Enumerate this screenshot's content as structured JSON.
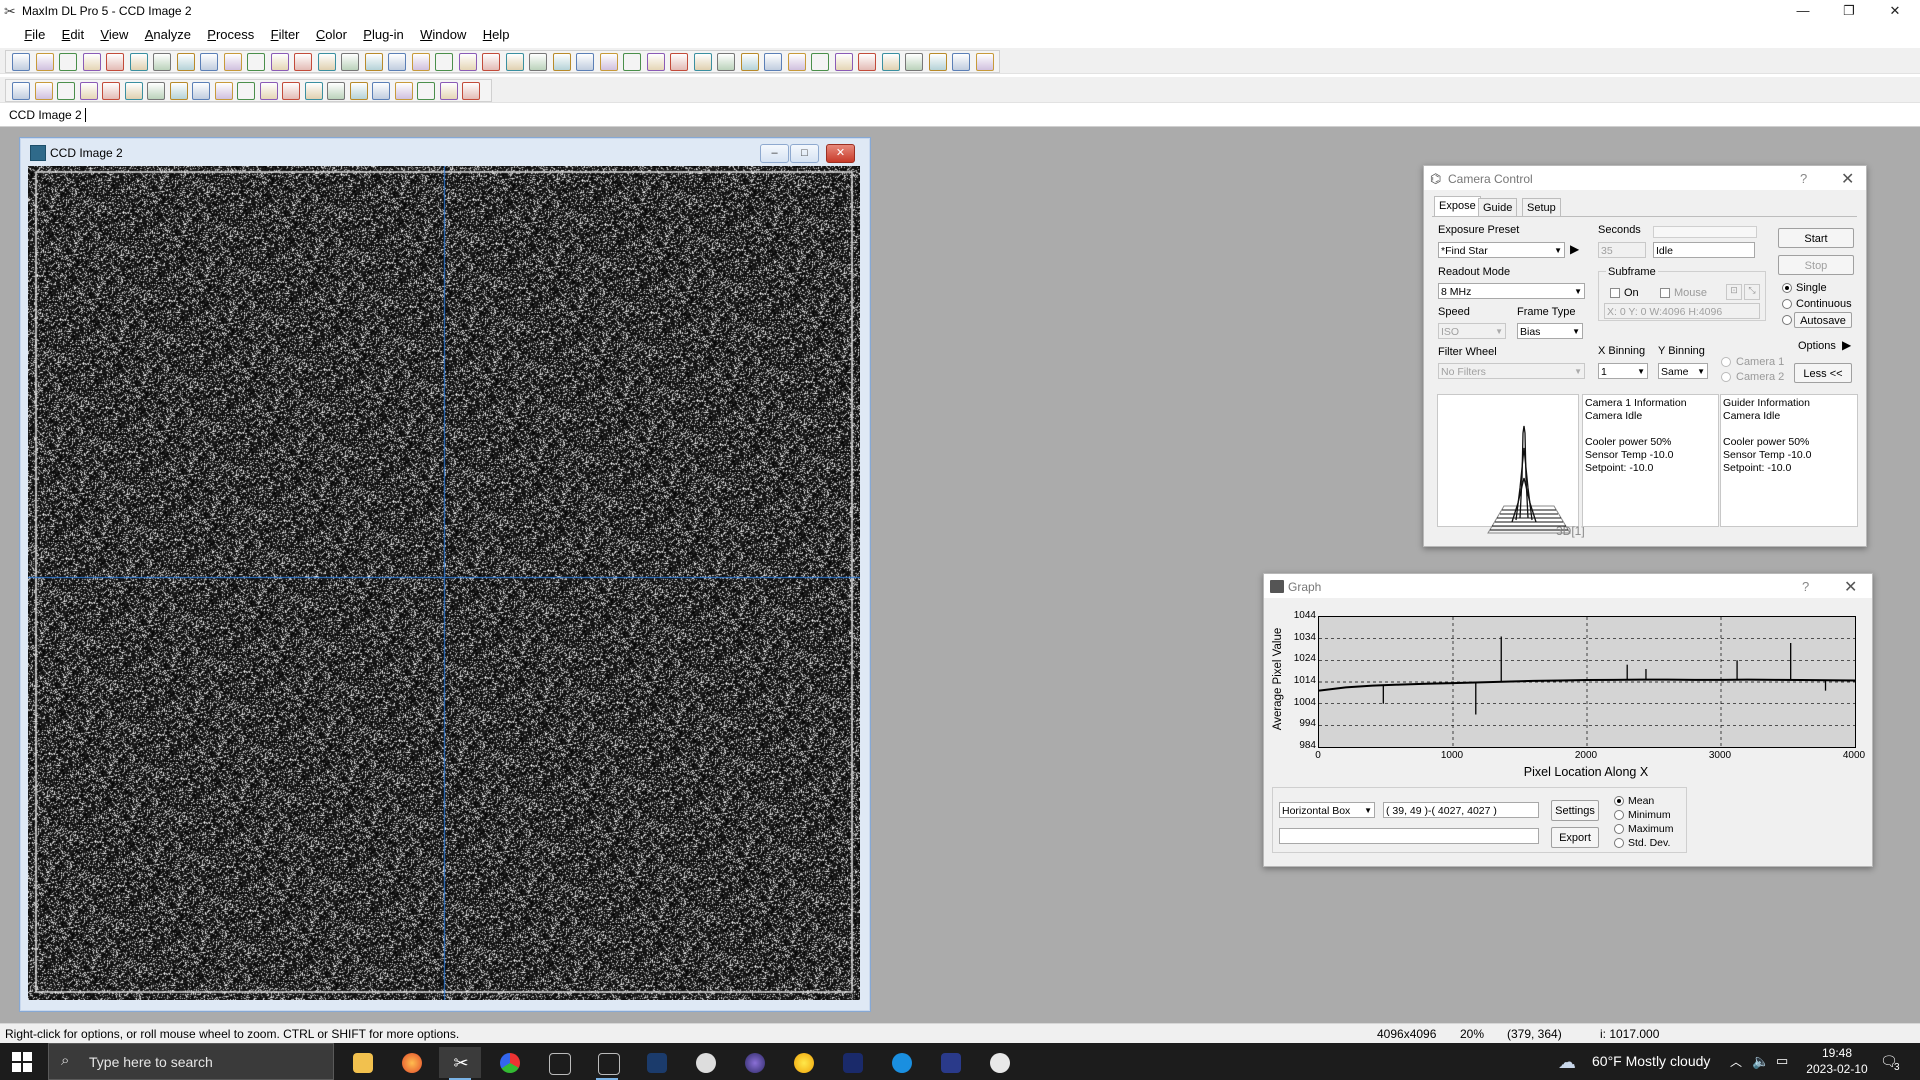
{
  "app": {
    "title": "MaxIm DL Pro 5 - CCD Image 2",
    "window_controls": {
      "minimize": "—",
      "restore": "❐",
      "close": "✕"
    }
  },
  "menu": [
    "File",
    "Edit",
    "View",
    "Analyze",
    "Process",
    "Filter",
    "Color",
    "Plug-in",
    "Window",
    "Help"
  ],
  "doc_tab": "CCD Image 2",
  "image_window": {
    "title": "CCD Image 2",
    "buttons": {
      "minimize": "–",
      "maximize": "□",
      "close": "✕"
    }
  },
  "camera_control": {
    "title": "Camera Control",
    "help": "?",
    "close": "✕",
    "tabs": [
      "Expose",
      "Guide",
      "Setup"
    ],
    "active_tab": "Expose",
    "exposure_preset_label": "Exposure Preset",
    "exposure_preset_value": "*Find Star",
    "seconds_label": "Seconds",
    "seconds_value": "35",
    "status_value": "Idle",
    "start": "Start",
    "stop": "Stop",
    "readout_mode_label": "Readout Mode",
    "readout_mode_value": "8 MHz",
    "subframe_label": "Subframe",
    "subframe_on": "On",
    "subframe_mouse": "Mouse",
    "subframe_coords": "X:   0 Y:   0 W:4096 H:4096",
    "mode_single": "Single",
    "mode_continuous": "Continuous",
    "mode_autosave": "Autosave",
    "speed_label": "Speed",
    "speed_value": "ISO",
    "frame_type_label": "Frame Type",
    "frame_type_value": "Bias",
    "options": "Options",
    "filter_wheel_label": "Filter Wheel",
    "filter_wheel_value": "No Filters",
    "x_binning_label": "X Binning",
    "x_binning_value": "1",
    "y_binning_label": "Y Binning",
    "y_binning_value": "Same",
    "camera1": "Camera 1",
    "camera2": "Camera 2",
    "less": "Less <<",
    "preview_label": "3D[1]",
    "camera1_info": "Camera 1 Information\nCamera Idle\n\nCooler power 50%\nSensor Temp -10.0\nSetpoint: -10.0",
    "guider_info": "Guider Information\nCamera Idle\n\nCooler power 50%\nSensor Temp -10.0\nSetpoint: -10.0"
  },
  "graph": {
    "title": "Graph",
    "help": "?",
    "close": "✕",
    "mode_value": "Horizontal Box",
    "region_value": "( 39, 49 )-( 4027, 4027 )",
    "settings": "Settings",
    "export": "Export",
    "stat_mean": "Mean",
    "stat_minimum": "Minimum",
    "stat_maximum": "Maximum",
    "stat_stddev": "Std. Dev.",
    "chart_data": {
      "type": "line",
      "title": "",
      "xlabel": "Pixel Location Along X",
      "ylabel": "Average Pixel Value",
      "xlim": [
        0,
        4000
      ],
      "ylim": [
        984,
        1044
      ],
      "xticks": [
        "0",
        "1000",
        "2000",
        "3000",
        "4000"
      ],
      "yticks": [
        "1044",
        "1034",
        "1024",
        "1014",
        "1004",
        "994",
        "984"
      ],
      "grid": true,
      "x": [
        0,
        200,
        400,
        600,
        800,
        1000,
        1200,
        1400,
        1600,
        1800,
        2000,
        2200,
        2400,
        2600,
        2800,
        3000,
        3200,
        3400,
        3600,
        3800,
        4000
      ],
      "y": [
        1010,
        1011.5,
        1012.3,
        1012.8,
        1013.2,
        1013.5,
        1013.8,
        1014.2,
        1014.5,
        1014.7,
        1014.9,
        1015.0,
        1015.1,
        1015.1,
        1015.0,
        1015.0,
        1015.1,
        1015.0,
        1014.9,
        1014.8,
        1014.7
      ],
      "spikes": [
        {
          "x": 480,
          "y": 1004
        },
        {
          "x": 1170,
          "y": 999
        },
        {
          "x": 1360,
          "y": 1035
        },
        {
          "x": 2300,
          "y": 1022
        },
        {
          "x": 2440,
          "y": 1020
        },
        {
          "x": 3120,
          "y": 1024
        },
        {
          "x": 3520,
          "y": 1032
        },
        {
          "x": 3780,
          "y": 1010
        }
      ]
    }
  },
  "status": {
    "hint": "Right-click for options, or roll mouse wheel to zoom. CTRL or SHIFT for more options.",
    "dimensions": "4096x4096",
    "zoom": "20%",
    "coords": "(379, 364)",
    "intensity": "i: 1017.000"
  },
  "taskbar": {
    "search_placeholder": "Type here to search",
    "weather": "60°F  Mostly cloudy",
    "time": "19:48",
    "date": "2023-02-10",
    "notifications": "3"
  }
}
